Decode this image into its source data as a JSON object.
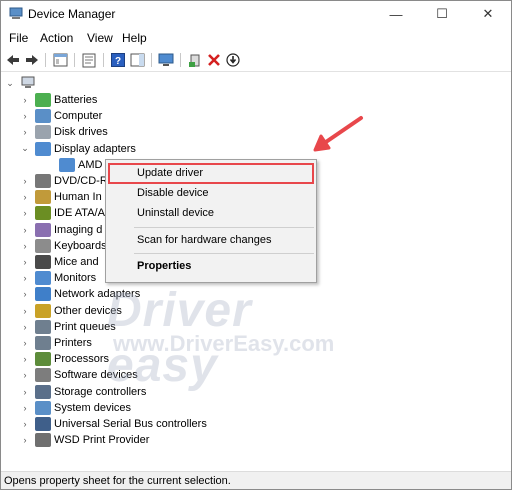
{
  "window": {
    "title": "Device Manager"
  },
  "titlebar": {
    "minimize_glyph": "—",
    "maximize_glyph": "☐",
    "close_glyph": "✕"
  },
  "menu": {
    "items": [
      "File",
      "Action",
      "View",
      "Help"
    ]
  },
  "toolbar": {
    "buttons": [
      "back-icon",
      "forward-icon",
      "show-hide-tree-icon",
      "properties-icon",
      "help-icon",
      "action-pane-icon",
      "monitor-icon",
      "add-driver-icon",
      "uninstall-icon",
      "disable-icon"
    ]
  },
  "tree": {
    "root_expander": "⌄",
    "items": [
      {
        "label": "Batteries",
        "expander": "›"
      },
      {
        "label": "Computer",
        "expander": "›"
      },
      {
        "label": "Disk drives",
        "expander": "›"
      },
      {
        "label": "Display adapters",
        "expander": "⌄"
      },
      {
        "label": "AMD",
        "expander": ""
      },
      {
        "label": "DVD/CD-R",
        "expander": "›"
      },
      {
        "label": "Human In",
        "expander": "›"
      },
      {
        "label": "IDE ATA/A",
        "expander": "›"
      },
      {
        "label": "Imaging d",
        "expander": "›"
      },
      {
        "label": "Keyboards",
        "expander": "›"
      },
      {
        "label": "Mice and",
        "expander": "›"
      },
      {
        "label": "Monitors",
        "expander": "›"
      },
      {
        "label": "Network adapters",
        "expander": "›"
      },
      {
        "label": "Other devices",
        "expander": "›"
      },
      {
        "label": "Print queues",
        "expander": "›"
      },
      {
        "label": "Printers",
        "expander": "›"
      },
      {
        "label": "Processors",
        "expander": "›"
      },
      {
        "label": "Software devices",
        "expander": "›"
      },
      {
        "label": "Storage controllers",
        "expander": "›"
      },
      {
        "label": "System devices",
        "expander": "›"
      },
      {
        "label": "Universal Serial Bus controllers",
        "expander": "›"
      },
      {
        "label": "WSD Print Provider",
        "expander": "›"
      }
    ]
  },
  "context_menu": {
    "update_driver": "Update driver",
    "disable_device": "Disable device",
    "uninstall_device": "Uninstall device",
    "scan_hardware": "Scan for hardware changes",
    "properties": "Properties"
  },
  "watermark": {
    "big": "Driver easy",
    "small": "www.DriverEasy.com"
  },
  "status": {
    "text": "Opens property sheet for the current selection."
  },
  "colors": {
    "highlight_border": "#e8474b",
    "arrow": "#e8474b"
  }
}
